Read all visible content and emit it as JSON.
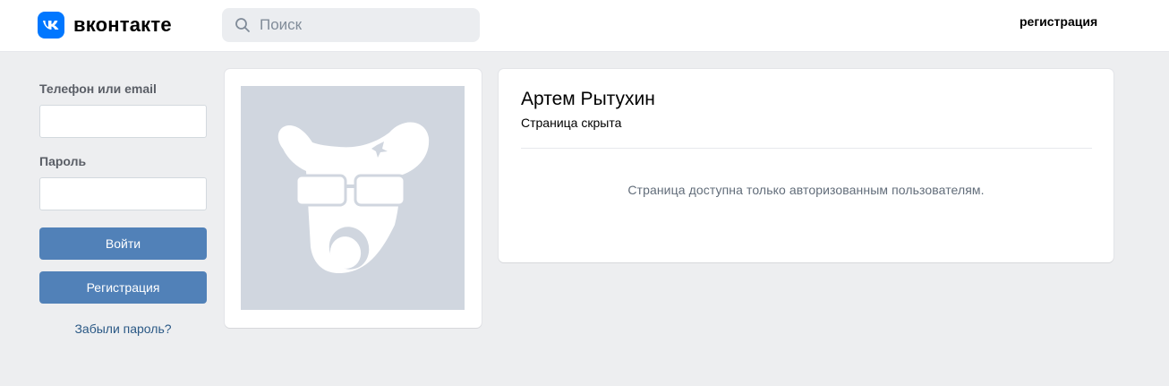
{
  "header": {
    "logo_text": "вконтакте",
    "logo_icon": "vk-logo-icon",
    "search": {
      "placeholder": "Поиск",
      "icon": "search-icon"
    },
    "register_link": "регистрация"
  },
  "login": {
    "phone_label": "Телефон или email",
    "password_label": "Пароль",
    "login_button": "Войти",
    "register_button": "Регистрация",
    "forgot_link": "Забыли пароль?"
  },
  "profile": {
    "avatar_icon": "default-dog-avatar-icon",
    "name": "Артем Рытухин",
    "status": "Страница скрыта",
    "notice": "Страница доступна только авторизованным пользователям."
  },
  "colors": {
    "brand": "#0077ff",
    "button": "#5181b8",
    "link": "#2a5885",
    "background": "#edeef0",
    "avatar_bg": "#d0d6df"
  }
}
